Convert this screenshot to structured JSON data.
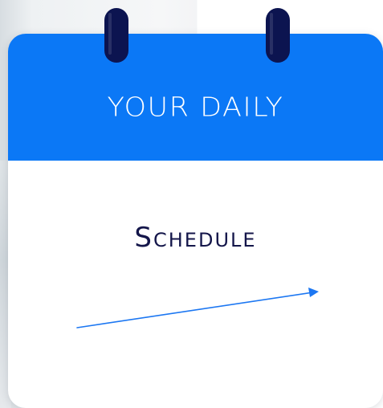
{
  "calendar": {
    "header_text": "YOUR DAILY",
    "body_text": "Schedule"
  },
  "colors": {
    "header_blue": "#0b78f6",
    "ring_navy": "#0c1450",
    "title_navy": "#14164a",
    "arrow_blue": "#1c77f2"
  },
  "icons": {
    "rings": "binder-ring-icon",
    "arrow": "arrow-right-icon"
  }
}
